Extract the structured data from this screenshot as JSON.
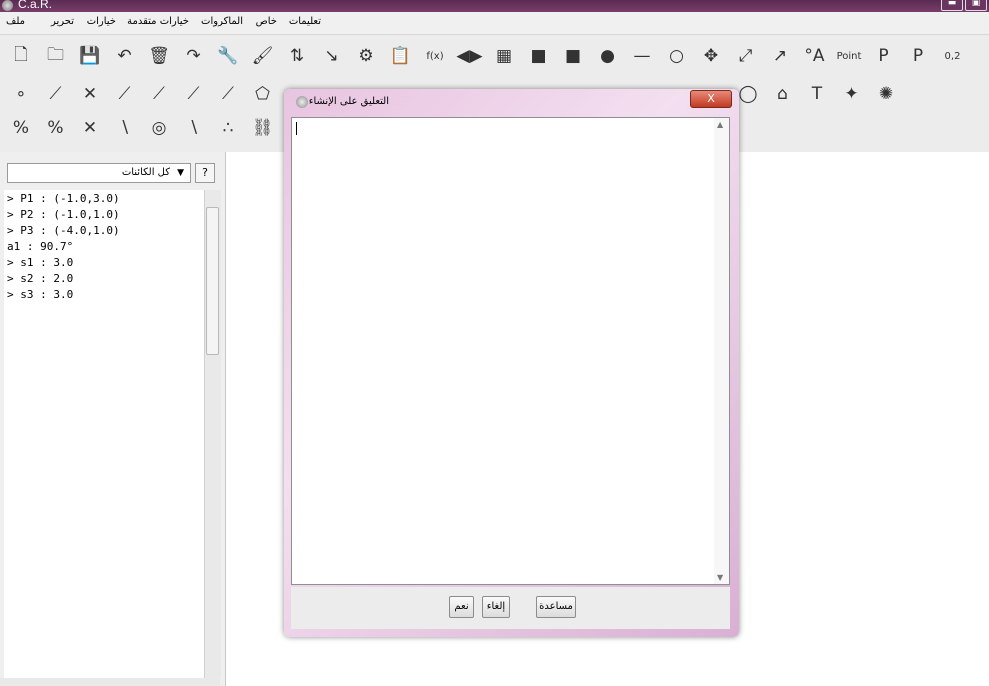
{
  "window": {
    "title": "C.a.R.",
    "minimize_label": "▬",
    "maximize_label": "▣"
  },
  "menu": {
    "items": [
      "ملف",
      "تحرير",
      "خيارات",
      "خيارات متقدمة",
      "الماكروات",
      "خاص",
      "تعليمات"
    ]
  },
  "toolbar": {
    "row1": [
      {
        "icon": "new-file-icon",
        "glyph": "🗋"
      },
      {
        "icon": "open-file-icon",
        "glyph": "🗀"
      },
      {
        "icon": "save-icon",
        "glyph": "💾"
      },
      {
        "icon": "undo-icon",
        "glyph": "↶"
      },
      {
        "icon": "delete-icon",
        "glyph": "🗑"
      },
      {
        "icon": "redo-icon",
        "glyph": "↷"
      },
      {
        "icon": "wrench-icon",
        "glyph": "🔧"
      },
      {
        "icon": "paint-icon",
        "glyph": "🖌"
      },
      {
        "icon": "sort-az-icon",
        "glyph": "⇅"
      },
      {
        "icon": "move-point-icon",
        "glyph": "↘"
      },
      {
        "icon": "macro-icon",
        "glyph": "⚙"
      },
      {
        "icon": "clipboard-icon",
        "glyph": "📋"
      },
      {
        "icon": "function-icon",
        "glyph": "f(x)"
      },
      {
        "icon": "reflect-icon",
        "glyph": "◀▶"
      },
      {
        "icon": "film-icon",
        "glyph": "▦"
      },
      {
        "icon": "filled-square-icon",
        "glyph": "■"
      },
      {
        "icon": "black-square-icon",
        "glyph": "■"
      },
      {
        "icon": "dot-icon",
        "glyph": "●"
      },
      {
        "icon": "line-style-icon",
        "glyph": "—"
      },
      {
        "icon": "circle-icon",
        "glyph": "○"
      },
      {
        "icon": "transform-icon",
        "glyph": "✥"
      },
      {
        "icon": "double-arrow-icon",
        "glyph": "⤢"
      },
      {
        "icon": "arrow-icon",
        "glyph": "↗"
      },
      {
        "icon": "point-label-icon",
        "glyph": "°A"
      },
      {
        "icon": "point-name-icon",
        "glyph": "Point"
      },
      {
        "icon": "large-p-icon",
        "glyph": "P"
      },
      {
        "icon": "small-p-icon",
        "glyph": "P"
      },
      {
        "icon": "coordinate-icon",
        "glyph": "0,2"
      }
    ],
    "row2": [
      {
        "icon": "point-tool-icon",
        "glyph": "∘"
      },
      {
        "icon": "segment-tool-icon",
        "glyph": "⟋"
      },
      {
        "icon": "intersection-tool-icon",
        "glyph": "✕"
      },
      {
        "icon": "line-tool-icon",
        "glyph": "⟋"
      },
      {
        "icon": "ray-tool-icon",
        "glyph": "⟋"
      },
      {
        "icon": "parallel-tool-icon",
        "glyph": "⟋"
      },
      {
        "icon": "vector-tool-icon",
        "glyph": "⟋"
      },
      {
        "icon": "polygon-tool-icon",
        "glyph": "⬠"
      },
      {
        "icon": "curve-tool-icon",
        "glyph": "◯"
      },
      {
        "icon": "area-tool-icon",
        "glyph": "⌂"
      },
      {
        "icon": "text-tool-icon",
        "glyph": "T"
      },
      {
        "icon": "magic-wand-icon",
        "glyph": "✦"
      },
      {
        "icon": "settings-gear-icon",
        "glyph": "✺"
      }
    ],
    "row3": [
      {
        "icon": "midpoint-tool-icon",
        "glyph": "%"
      },
      {
        "icon": "perpendicular-tool-icon",
        "glyph": "%"
      },
      {
        "icon": "cross-tool-icon",
        "glyph": "✕"
      },
      {
        "icon": "angle-tool-icon",
        "glyph": "∖"
      },
      {
        "icon": "circle-center-tool-icon",
        "glyph": "◎"
      },
      {
        "icon": "reflection-tool-icon",
        "glyph": "∖"
      },
      {
        "icon": "locus-tool-icon",
        "glyph": "∴"
      },
      {
        "icon": "chain-tool-icon",
        "glyph": "⛓"
      }
    ]
  },
  "left_panel": {
    "filter_value": "كل الكائنات",
    "help_label": "?",
    "objects": [
      "> P1 : (-1.0,3.0)",
      "> P2 : (-1.0,1.0)",
      "> P3 : (-4.0,1.0)",
      "a1 : 90.7°",
      "> s1 : 3.0",
      "> s2 : 2.0",
      "> s3 : 3.0"
    ]
  },
  "dialog": {
    "title": "التعليق على الإنشاء",
    "close_label": "X",
    "text_value": "",
    "buttons": {
      "ok": "نعم",
      "cancel": "إلغاء",
      "help": "مساعدة"
    }
  }
}
